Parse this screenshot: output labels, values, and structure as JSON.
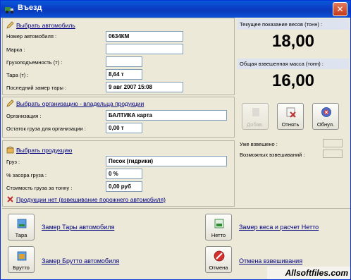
{
  "window": {
    "title": "Въезд",
    "close_symbol": "✕"
  },
  "vehicle": {
    "link": "Выбрать автомобиль",
    "fields": [
      {
        "label": "Номер автомобиля :",
        "value": "0634КМ"
      },
      {
        "label": "Марка :",
        "value": ""
      },
      {
        "label": "Грузоподъемность (т) :",
        "value": ""
      },
      {
        "label": "Тара (т) :",
        "value": "8,64 т"
      },
      {
        "label": "Последний замер тары :",
        "value": "9 авг 2007 15:08"
      }
    ]
  },
  "organization": {
    "link": "Выбрать организацию - владельца продукции",
    "fields": [
      {
        "label": "Организация :",
        "value": "БАЛТИКА карта"
      },
      {
        "label": "Остаток груза для организации :",
        "value": "0,00 т"
      }
    ]
  },
  "product": {
    "link": "Выбрать продукцию",
    "fields": [
      {
        "label": "Груз :",
        "value": "Песок (гидрики)"
      },
      {
        "label": "% засора груза :",
        "value": "0 %"
      },
      {
        "label": "Стоимость груза за тонну :",
        "value": "0,00 руб"
      }
    ],
    "no_product_link": "Продукции нет (взвешивание порожнего автомобиля)"
  },
  "scale": {
    "current_label": "Текущее показание весов (тонн) :",
    "current_value": "18,00",
    "total_label": "Общая взвешенная масса (тонн) :",
    "total_value": "16,00",
    "buttons": {
      "add": "Добав.",
      "reject": "Отнять",
      "reset": "Обнул."
    },
    "already_label": "Уже взвешено :",
    "possible_label": "Возможных взвешиваний :"
  },
  "actions": {
    "tare_button": "Тара",
    "tare_link": "Замер Тары автомобиля",
    "brutto_button": "Брутто",
    "brutto_link": "Замер Брутто автомобиля",
    "netto_button": "Нетто",
    "netto_link": "Замер веса и расчет Нетто",
    "cancel_button": "Отмена",
    "cancel_link": "Отмена взвешивания"
  },
  "watermark": "Allsoftfiles.com"
}
